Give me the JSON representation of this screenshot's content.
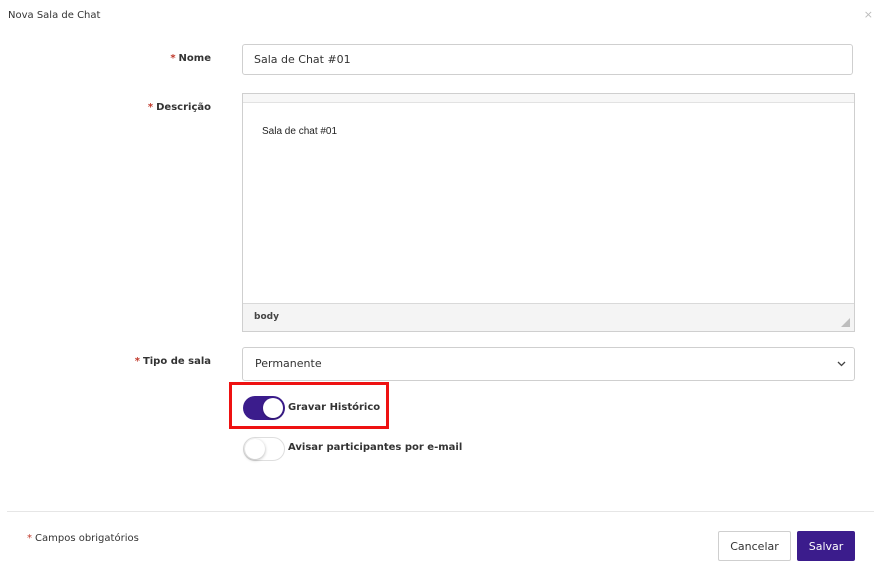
{
  "modal": {
    "title": "Nova Sala de Chat",
    "close_glyph": "×"
  },
  "form": {
    "required_mark": "*",
    "nome": {
      "label": "Nome",
      "value": "Sala de Chat #01"
    },
    "descricao": {
      "label": "Descrição",
      "content": "Sala de chat #01",
      "status_path": "body"
    },
    "tipo_sala": {
      "label": "Tipo de sala",
      "selected": "Permanente"
    },
    "gravar_historico": {
      "label": "Gravar Histórico",
      "enabled": true
    },
    "avisar_email": {
      "label": "Avisar participantes por e-mail",
      "enabled": false
    }
  },
  "footer": {
    "required_note": "Campos obrigatórios",
    "cancel_label": "Cancelar",
    "save_label": "Salvar"
  },
  "colors": {
    "accent": "#3b1c8c",
    "required": "#c0392b",
    "highlight": "#ee1111"
  }
}
